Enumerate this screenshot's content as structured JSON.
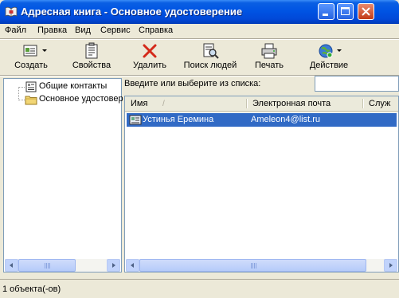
{
  "window": {
    "title": "Адресная книга - Основное удостоверение",
    "icon": "address-book-icon",
    "title_bar_color": "#0054e3"
  },
  "menu": [
    "Файл",
    "Правка",
    "Вид",
    "Сервис",
    "Справка"
  ],
  "toolbar": {
    "buttons": [
      {
        "label": "Создать",
        "icon": "new-contact-icon",
        "has_dropdown": true
      },
      {
        "label": "Свойства",
        "icon": "properties-icon",
        "has_dropdown": false
      },
      {
        "label": "Удалить",
        "icon": "delete-icon",
        "has_dropdown": false
      },
      {
        "label": "Поиск людей",
        "icon": "find-people-icon",
        "has_dropdown": false
      },
      {
        "label": "Печать",
        "icon": "print-icon",
        "has_dropdown": false
      },
      {
        "label": "Действие",
        "icon": "action-icon",
        "has_dropdown": true
      }
    ]
  },
  "folders": [
    {
      "label": "Общие контакты",
      "icon": "shared-contacts-icon"
    },
    {
      "label": "Основное удостовер",
      "icon": "folder-icon"
    }
  ],
  "search": {
    "label": "Введите или выберите из списка:",
    "value": ""
  },
  "list": {
    "columns": [
      "Имя",
      "Электронная почта",
      "Служ"
    ],
    "rows": [
      {
        "name": "Устинья Еремина",
        "email": "Ameleon4@list.ru",
        "selected": true
      }
    ],
    "selection_color": "#316ac5"
  },
  "status": {
    "text": "1 объекта(-ов)"
  }
}
